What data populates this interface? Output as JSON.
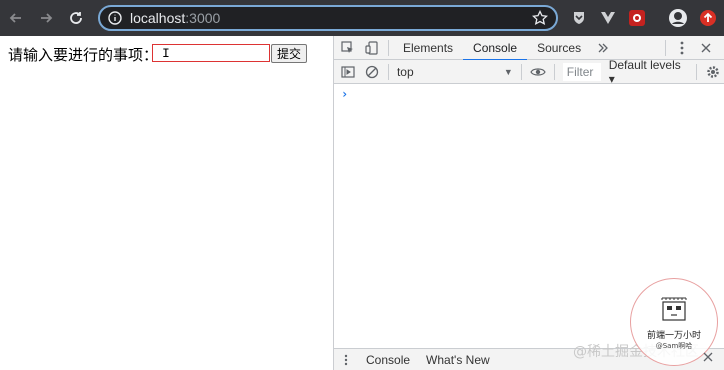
{
  "browser": {
    "url_host": "localhost",
    "url_port": ":3000"
  },
  "page": {
    "prompt_label": "请输入要进行的事项：",
    "input_value": "",
    "submit_label": "提交"
  },
  "devtools": {
    "tabs": [
      {
        "label": "Elements"
      },
      {
        "label": "Console"
      },
      {
        "label": "Sources"
      }
    ],
    "context": "top",
    "filter_placeholder": "Filter",
    "levels": "Default levels ▾",
    "prompt_symbol": "›",
    "drawer_tabs": [
      {
        "label": "Console"
      },
      {
        "label": "What's New"
      }
    ]
  },
  "overlay": {
    "watermark": "@稀土掘金技术社区",
    "seal_text": "前端一万小时",
    "seal_sub": "@Sam啊哈"
  },
  "colors": {
    "accent": "#1a73e8",
    "toolbar_bg": "#35363a",
    "input_border": "#dd3333"
  }
}
